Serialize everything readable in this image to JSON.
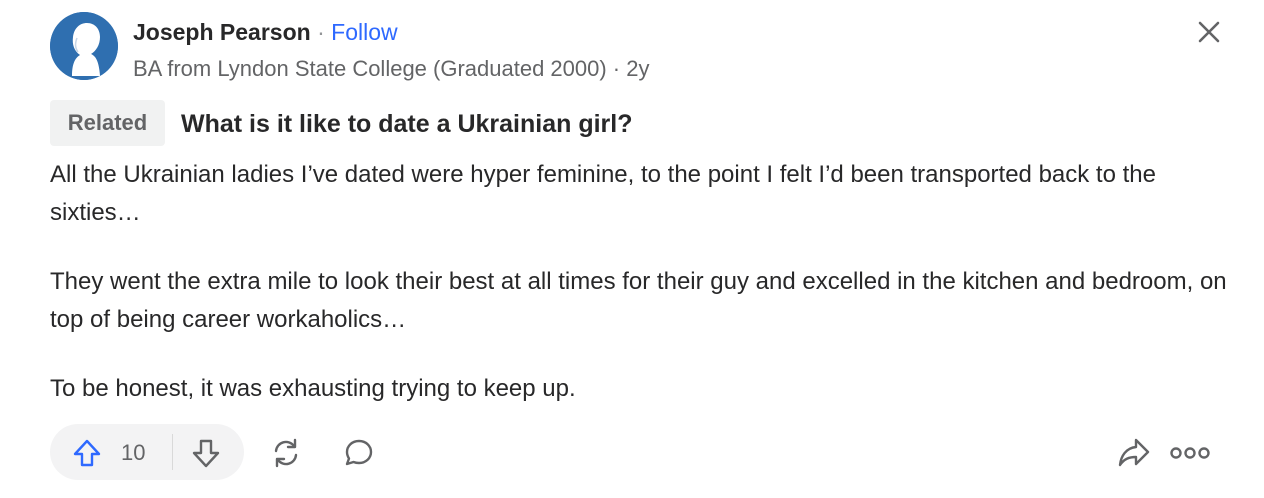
{
  "author": {
    "name": "Joseph Pearson",
    "separator": " · ",
    "follow_label": "Follow",
    "credential": "BA from Lyndon State College (Graduated 2000) · 2y"
  },
  "related": {
    "badge_label": "Related",
    "question": "What is it like to date a Ukrainian girl?"
  },
  "answer": {
    "paragraphs": [
      "All the Ukrainian ladies I’ve dated were hyper feminine, to the point I felt I’d been transported back to the sixties…",
      "They went the extra mile to look their best at all times for their guy and excelled in the kitchen and bedroom, on top of being career workaholics…",
      "To be honest, it was exhausting trying to keep up."
    ]
  },
  "actions": {
    "upvote_count": "10",
    "icons": [
      "close-icon",
      "upvote-arrow-icon",
      "downvote-arrow-icon",
      "share-reload-icon",
      "comment-bubble-icon",
      "forward-share-icon",
      "more-dots-icon"
    ]
  },
  "colors": {
    "accent": "#2e69ff",
    "avatar": "#2f6fb0",
    "text": "#282829",
    "muted": "#636466",
    "pill_bg": "#f3f3f4"
  }
}
